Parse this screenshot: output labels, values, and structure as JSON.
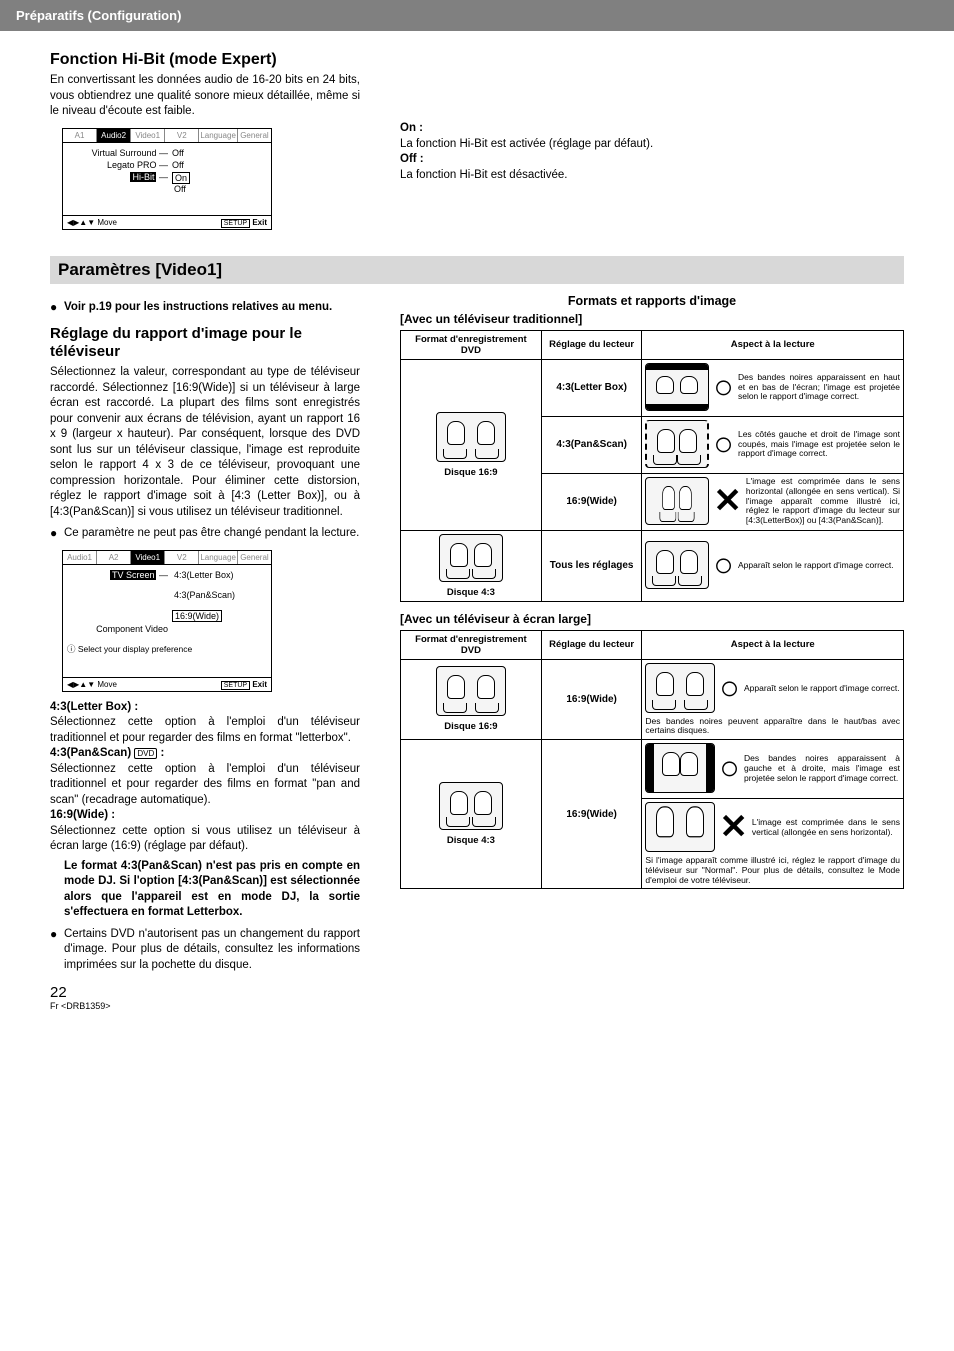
{
  "header": {
    "breadcrumb": "Préparatifs (Configuration)"
  },
  "hibit": {
    "title": "Fonction Hi-Bit (mode Expert)",
    "desc": "En convertissant les données audio de 16-20 bits en 24 bits, vous obtiendrez une qualité sonore mieux détaillée, même si le niveau d'écoute est faible.",
    "on_label": "On :",
    "on_desc": "La fonction Hi-Bit est activée (réglage par défaut).",
    "off_label": "Off :",
    "off_desc": "La fonction Hi-Bit est désactivée."
  },
  "screen1": {
    "tabs": [
      "A1",
      "Audio2",
      "Video1",
      "V2",
      "Language",
      "General"
    ],
    "rows": [
      {
        "label": "Virtual Surround —",
        "opt": "Off"
      },
      {
        "label": "Legato PRO —",
        "opt": "Off"
      },
      {
        "label": "Hi-Bit —",
        "opts": [
          "On",
          "Off"
        ],
        "sel": 0
      }
    ],
    "move": "Move",
    "setup": "SETUP",
    "exit": "Exit"
  },
  "section_bar": "Paramètres [Video1]",
  "bullet_instructions": "Voir p.19 pour les instructions relatives au menu.",
  "tv": {
    "title": "Réglage du rapport d'image pour le téléviseur",
    "p1": "Sélectionnez la valeur, correspondant au type de téléviseur raccordé. Sélectionnez [16:9(Wide)] si un téléviseur à large écran est raccordé. La plupart des films sont enregistrés pour convenir aux écrans de télévision, ayant un rapport 16 x 9 (largeur x hauteur). Par conséquent, lorsque des DVD sont lus sur un téléviseur classique, l'image est reproduite selon le rapport 4 x 3 de ce téléviseur, provoquant une compression horizontale. Pour éliminer cette distorsion, réglez le rapport d'image soit à [4:3 (Letter Box)], ou à [4:3(Pan&Scan)] si vous utilisez un téléviseur traditionnel.",
    "bullet_nochange": "Ce paramètre ne peut pas être changé pendant la lecture.",
    "lb_label": "4:3(Letter Box) :",
    "lb_desc": "Sélectionnez cette option à l'emploi d'un téléviseur traditionnel et pour regarder des films en format \"letterbox\".",
    "ps_label": "4:3(Pan&Scan)",
    "ps_badge": "DVD",
    "ps_colon": " :",
    "ps_desc": "Sélectionnez cette option à l'emploi d'un téléviseur traditionnel et pour regarder des films en format \"pan and scan\" (recadrage automatique).",
    "wide_label": "16:9(Wide) :",
    "wide_desc": "Sélectionnez cette option si vous utilisez un téléviseur à écran large (16:9) (réglage par défaut).",
    "dj_note": "Le format 4:3(Pan&Scan) n'est pas pris en compte en mode DJ. Si l'option [4:3(Pan&Scan)] est sélectionnée alors que l'appareil est en mode DJ, la sortie s'effectuera en format Letterbox.",
    "bullet_dvd": "Certains DVD n'autorisent pas un changement du rapport d'image. Pour plus de détails, consultez les informations imprimées sur la pochette du disque."
  },
  "screen2": {
    "tabs": [
      "Audio1",
      "A2",
      "Video1",
      "V2",
      "Language",
      "General"
    ],
    "rows": [
      {
        "label": "TV Screen —",
        "opts": [
          "4:3(Letter Box)",
          "4:3(Pan&Scan)",
          "16:9(Wide)"
        ],
        "sel": 2
      },
      {
        "label": "Component Video",
        "opt": ""
      }
    ],
    "info": "Select your display preference",
    "move": "Move",
    "setup": "SETUP",
    "exit": "Exit"
  },
  "formats": {
    "title": "Formats et rapports d'image",
    "sub1": "[Avec un téléviseur traditionnel]",
    "sub2": "[Avec un téléviseur à écran large]",
    "th1": "Format d'enregistrement DVD",
    "th2": "Réglage du lecteur",
    "th3": "Aspect à la lecture",
    "disc169": "Disque 16:9",
    "disc43": "Disque 4:3",
    "lb": "4:3(Letter Box)",
    "ps": "4:3(Pan&Scan)",
    "wide": "16:9(Wide)",
    "all": "Tous les réglages",
    "r1": "Des bandes noires apparaissent en haut et en bas de l'écran; l'image est projetée selon le rapport d'image correct.",
    "r2": "Les côtés gauche et droit de l'image sont coupés, mais l'image est projetée selon le rapport d'image correct.",
    "r3": "L'image est comprimée dans le sens horizontal (allongée en sens vertical). Si l'image apparaît comme illustré ici, réglez le rapport d'image du lecteur sur [4:3(LetterBox)] ou [4:3(Pan&Scan)].",
    "r4": "Apparaît selon le rapport d'image correct.",
    "r5": "Apparaît selon le rapport d'image correct.",
    "r5b": "Des bandes noires peuvent apparaître dans le haut/bas avec certains disques.",
    "r6": "Des bandes noires apparaissent à gauche et à droite, mais l'image est projetée selon le rapport d'image correct.",
    "r7": "L'image est comprimée dans le sens vertical (allongée en sens horizontal).",
    "r7b": "Si l'image apparaît comme illustré ici, réglez le rapport d'image du téléviseur sur \"Normal\". Pour plus de détails, consultez le Mode d'emploi de votre téléviseur."
  },
  "footer": {
    "page": "22",
    "code": "Fr <DRB1359>"
  }
}
